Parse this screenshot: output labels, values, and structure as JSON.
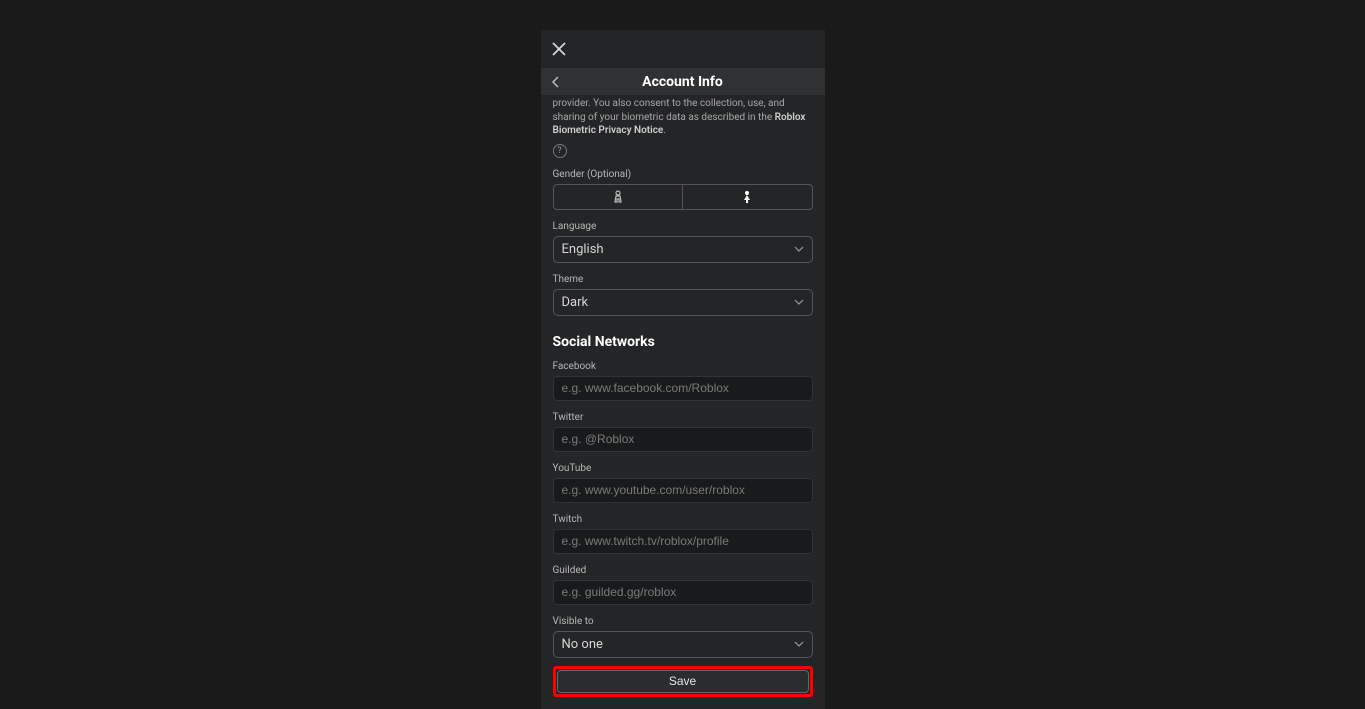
{
  "header": {
    "title": "Account Info"
  },
  "consent": {
    "text_fragment": "provider. You also consent to the collection, use, and sharing of your biometric data as described in the ",
    "privacy_link": "Roblox Biometric Privacy Notice",
    "period": "."
  },
  "labels": {
    "gender": "Gender (Optional)",
    "language": "Language",
    "theme": "Theme",
    "social_networks": "Social Networks",
    "facebook": "Facebook",
    "twitter": "Twitter",
    "youtube": "YouTube",
    "twitch": "Twitch",
    "guilded": "Guilded",
    "visible_to": "Visible to"
  },
  "selects": {
    "language": "English",
    "theme": "Dark",
    "visible_to": "No one"
  },
  "placeholders": {
    "facebook": "e.g. www.facebook.com/Roblox",
    "twitter": "e.g. @Roblox",
    "youtube": "e.g. www.youtube.com/user/roblox",
    "twitch": "e.g. www.twitch.tv/roblox/profile",
    "guilded": "e.g. guilded.gg/roblox"
  },
  "buttons": {
    "save": "Save"
  }
}
